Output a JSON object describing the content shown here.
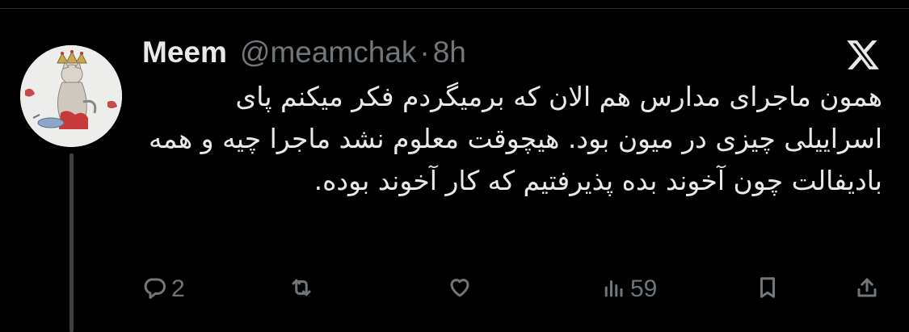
{
  "tweet": {
    "author_name": "Meem",
    "handle": "@meamchak",
    "separator": "·",
    "time": "8h",
    "text": "همون ماجرای مدارس هم الان که برمیگردم فکر میکنم پای اسراییلی چیزی در میون بود. هیچوقت معلوم نشد ماجرا چیه و همه بادیفالت چون آخوند بده پذیرفتیم که کار آخوند بوده."
  },
  "actions": {
    "reply_count": "2",
    "retweet_count": "",
    "like_count": "",
    "views_count": "59"
  },
  "icons": {
    "brand": "x-logo-icon",
    "reply": "reply-icon",
    "retweet": "retweet-icon",
    "like": "heart-icon",
    "views": "views-icon",
    "bookmark": "bookmark-icon",
    "share": "share-icon"
  },
  "colors": {
    "background": "#000000",
    "primary_text": "#e7e9ea",
    "secondary_text": "#71767b"
  }
}
